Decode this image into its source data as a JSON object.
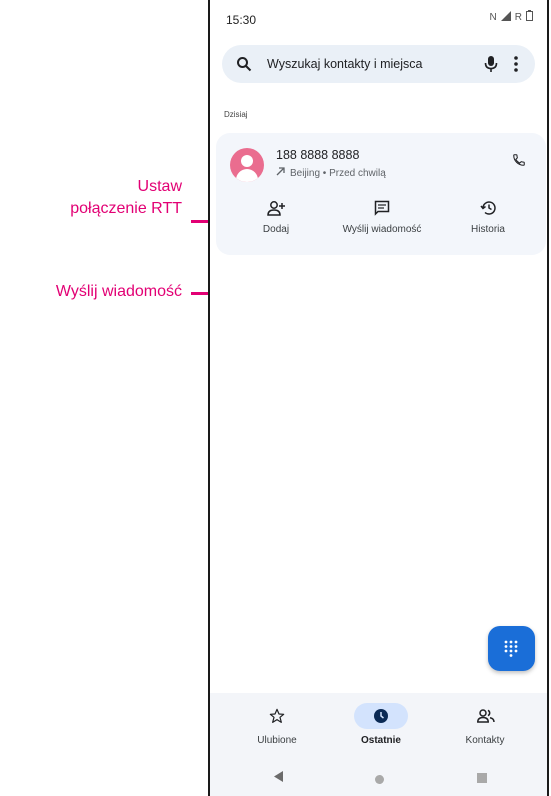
{
  "status_bar": {
    "time": "15:30",
    "icons": [
      "nfc-icon",
      "signal-icon",
      "roaming-icon",
      "battery-icon"
    ],
    "roaming_label": "R"
  },
  "search": {
    "placeholder": "Wyszukaj kontakty i miejsca"
  },
  "section_label": "Dzisiaj",
  "call_entry": {
    "number": "188 8888 8888",
    "detail": "Beijing • Przed chwilą",
    "actions": [
      {
        "label": "Dodaj",
        "icon": "add-contact-icon"
      },
      {
        "label": "Wyślij wiadomość",
        "icon": "message-icon"
      },
      {
        "label": "Historia",
        "icon": "history-icon"
      }
    ]
  },
  "bottom_nav": [
    {
      "label": "Ulubione",
      "icon": "star-icon",
      "active": false
    },
    {
      "label": "Ostatnie",
      "icon": "clock-icon",
      "active": true
    },
    {
      "label": "Kontakty",
      "icon": "contacts-icon",
      "active": false
    }
  ],
  "annotations": {
    "rtt_line1": "Ustaw",
    "rtt_line2": "połączenie RTT",
    "message": "Wyślij wiadomość"
  },
  "colors": {
    "accent": "#e20074",
    "fab": "#1a6ed8",
    "avatar": "#ea6d8f",
    "active_pill": "#d3e3fd"
  }
}
